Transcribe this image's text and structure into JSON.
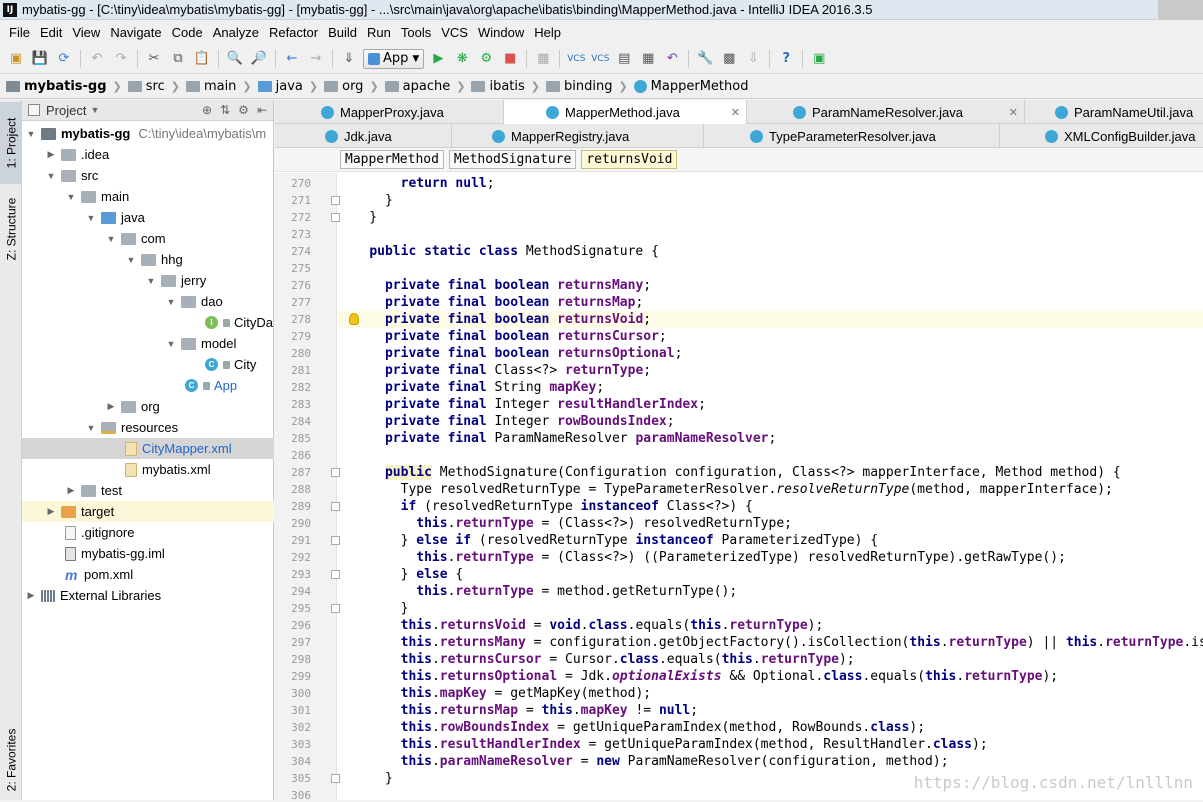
{
  "window": {
    "title": "mybatis-gg - [C:\\tiny\\idea\\mybatis\\mybatis-gg] - [mybatis-gg] - ...\\src\\main\\java\\org\\apache\\ibatis\\binding\\MapperMethod.java - IntelliJ IDEA 2016.3.5",
    "icon_text": "IJ"
  },
  "menu": [
    "File",
    "Edit",
    "View",
    "Navigate",
    "Code",
    "Analyze",
    "Refactor",
    "Build",
    "Run",
    "Tools",
    "VCS",
    "Window",
    "Help"
  ],
  "toolbar": {
    "run_config": "App"
  },
  "breadcrumb": [
    "mybatis-gg",
    "src",
    "main",
    "java",
    "org",
    "apache",
    "ibatis",
    "binding",
    "MapperMethod"
  ],
  "side_tabs": {
    "project": "1: Project",
    "structure": "Z: Structure",
    "favorites": "2: Favorites"
  },
  "project_panel": {
    "title": "Project",
    "root_path": "C:\\tiny\\idea\\mybatis\\m",
    "items": [
      {
        "label": "mybatis-gg",
        "icon": "project-folder-icon"
      },
      {
        "label": ".idea",
        "icon": "folder-icon"
      },
      {
        "label": "src",
        "icon": "folder-icon"
      },
      {
        "label": "main",
        "icon": "folder-icon"
      },
      {
        "label": "java",
        "icon": "source-folder-icon"
      },
      {
        "label": "com",
        "icon": "package-icon"
      },
      {
        "label": "hhg",
        "icon": "package-icon"
      },
      {
        "label": "jerry",
        "icon": "package-icon"
      },
      {
        "label": "dao",
        "icon": "package-icon"
      },
      {
        "label": "CityDa",
        "icon": "interface-icon"
      },
      {
        "label": "model",
        "icon": "package-icon"
      },
      {
        "label": "City",
        "icon": "class-icon"
      },
      {
        "label": "App",
        "icon": "class-icon"
      },
      {
        "label": "org",
        "icon": "package-icon"
      },
      {
        "label": "resources",
        "icon": "resources-folder-icon"
      },
      {
        "label": "CityMapper.xml",
        "icon": "xml-file-icon"
      },
      {
        "label": "mybatis.xml",
        "icon": "xml-file-icon"
      },
      {
        "label": "test",
        "icon": "folder-icon"
      },
      {
        "label": "target",
        "icon": "excluded-folder-icon"
      },
      {
        "label": ".gitignore",
        "icon": "file-icon"
      },
      {
        "label": "mybatis-gg.iml",
        "icon": "iml-file-icon"
      },
      {
        "label": "pom.xml",
        "icon": "maven-icon"
      },
      {
        "label": "External Libraries",
        "icon": "libraries-icon"
      }
    ]
  },
  "tabs_row1": [
    "MapperProxy.java",
    "MapperMethod.java",
    "ParamNameResolver.java",
    "ParamNameUtil.java"
  ],
  "tabs_row2": [
    "Jdk.java",
    "MapperRegistry.java",
    "TypeParameterResolver.java",
    "XMLConfigBuilder.java"
  ],
  "editor_breadcrumb": [
    "MapperMethod",
    "MethodSignature",
    "returnsVoid"
  ],
  "line_numbers": [
    "270",
    "271",
    "272",
    "273",
    "274",
    "275",
    "276",
    "277",
    "278",
    "279",
    "280",
    "281",
    "282",
    "283",
    "284",
    "285",
    "286",
    "287",
    "288",
    "289",
    "290",
    "291",
    "292",
    "293",
    "294",
    "295",
    "296",
    "297",
    "298",
    "299",
    "300",
    "301",
    "302",
    "303",
    "304",
    "305",
    "306"
  ],
  "watermark": "https://blog.csdn.net/lnlllnn",
  "colors": {
    "keyword": "#000080",
    "field": "#660e7a",
    "current_line": "#fdfae5",
    "selection": "#d5d5d5"
  }
}
